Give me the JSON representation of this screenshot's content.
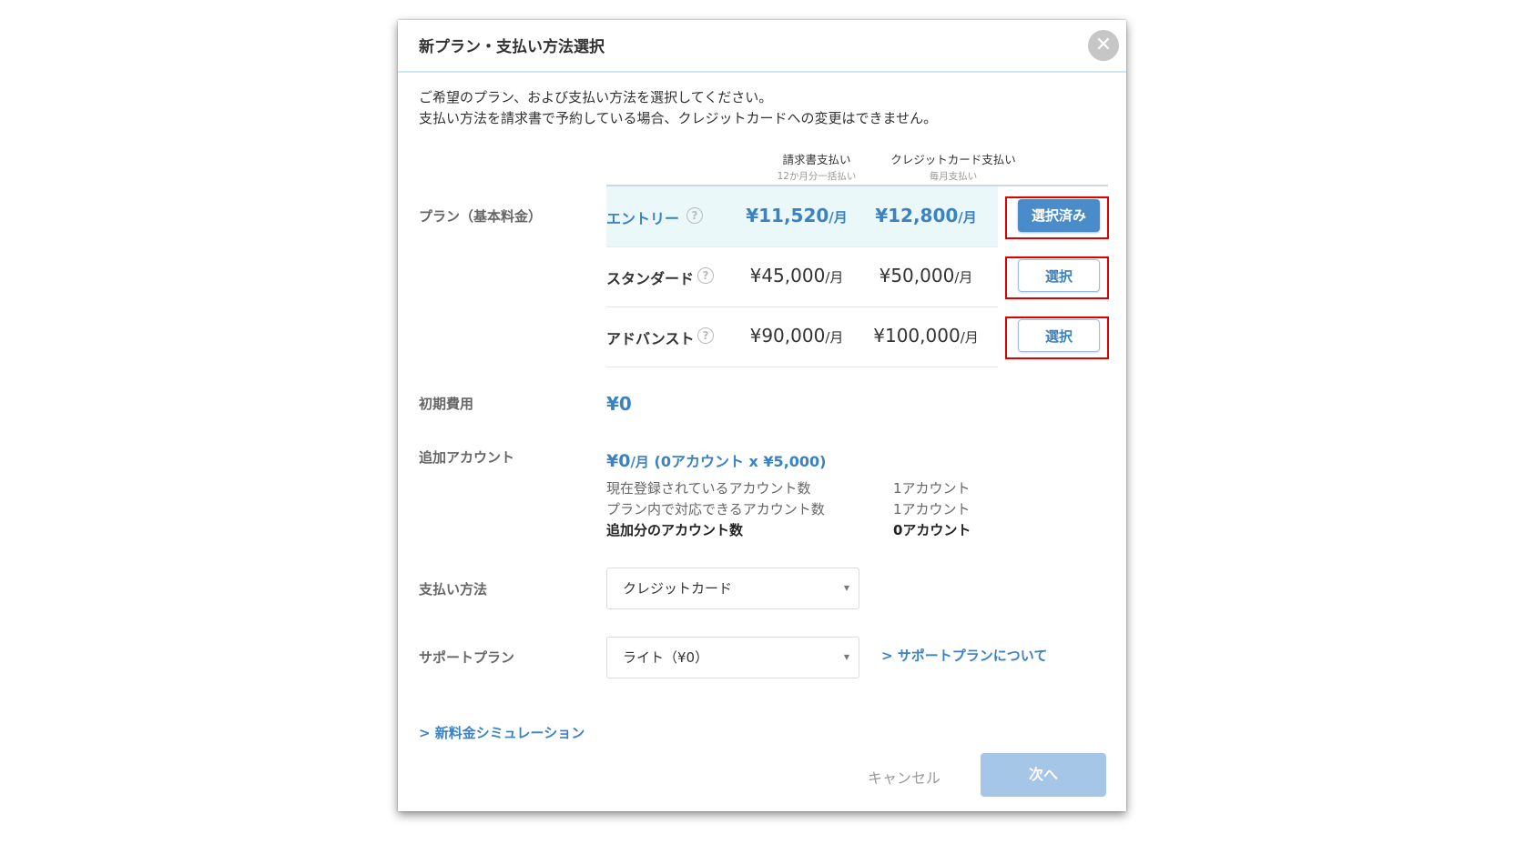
{
  "modal": {
    "title": "新プラン・支払い方法選択",
    "close_icon": "close-icon",
    "intro_line1": "ご希望のプラン、および支払い方法を選択してください。",
    "intro_line2": "支払い方法を請求書で予約している場合、クレジットカードへの変更はできません。"
  },
  "plan_table": {
    "section_label": "プラン（基本料金）",
    "col_invoice": "請求書支払い",
    "col_invoice_sub": "12か月分一括払い",
    "col_card": "クレジットカード支払い",
    "col_card_sub": "毎月支払い",
    "unit": "/月",
    "help_icon": "?",
    "rows": [
      {
        "name": "エントリー",
        "invoice_price": "¥11,520",
        "card_price": "¥12,800",
        "button": "選択済み",
        "selected": true
      },
      {
        "name": "スタンダード",
        "invoice_price": "¥45,000",
        "card_price": "¥50,000",
        "button": "選択",
        "selected": false
      },
      {
        "name": "アドバンスト",
        "invoice_price": "¥90,000",
        "card_price": "¥100,000",
        "button": "選択",
        "selected": false
      }
    ]
  },
  "initial_fee": {
    "label": "初期費用",
    "value": "¥0"
  },
  "additional_accounts": {
    "label": "追加アカウント",
    "amount": "¥0",
    "unit": "/月",
    "detail": "(0アカウント x ¥5,000)",
    "rows": [
      {
        "label": "現在登録されているアカウント数",
        "value": "1アカウント"
      },
      {
        "label": "プラン内で対応できるアカウント数",
        "value": "1アカウント"
      },
      {
        "label": "追加分のアカウント数",
        "value": "0アカウント"
      }
    ]
  },
  "payment_method": {
    "label": "支払い方法",
    "value": "クレジットカード"
  },
  "support_plan": {
    "label": "サポートプラン",
    "value": "ライト（¥0）",
    "link": "> サポートプランについて"
  },
  "footer": {
    "simulation_link": "> 新料金シミュレーション",
    "cancel": "キャンセル",
    "next": "次へ"
  },
  "colors": {
    "accent": "#3b82c4",
    "primary_button": "#4a8bc9",
    "disabled_button": "#a5c6e6",
    "selected_row_bg": "#eaf8fa",
    "highlight_box": "#e00000"
  }
}
